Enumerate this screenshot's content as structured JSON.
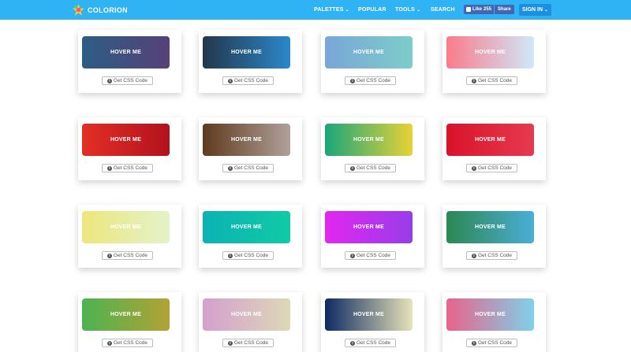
{
  "header": {
    "brand": "COLORION",
    "nav": [
      {
        "label": "PALETTES",
        "caret": "⌄"
      },
      {
        "label": "POPULAR",
        "caret": ""
      },
      {
        "label": "TOOLS",
        "caret": "⌄"
      },
      {
        "label": "SEARCH",
        "caret": ""
      }
    ],
    "facebook": {
      "like_label": "Like",
      "like_count": "255",
      "share_label": "Share"
    },
    "signin_label": "SIGN IN",
    "signin_caret": "⌄"
  },
  "gradients": {
    "button_label": "HOVER ME",
    "code_button_label": "Get CSS Code",
    "items": [
      {
        "from": "#2c5d84",
        "to": "#574178"
      },
      {
        "from": "#23374a",
        "to": "#2b88cb"
      },
      {
        "from": "#7aa6d8",
        "to": "#7ccdc9"
      },
      {
        "from": "#fa7b8a",
        "to": "#cfe8fb"
      },
      {
        "from": "#e42f26",
        "to": "#b2121d"
      },
      {
        "from": "#5f3a1d",
        "to": "#b0a09a"
      },
      {
        "from": "#1aa67a",
        "to": "#e8d236"
      },
      {
        "from": "#d8132a",
        "to": "#e73a4f"
      },
      {
        "from": "#ece67c",
        "to": "#e4f3c9"
      },
      {
        "from": "#0cb2b3",
        "to": "#10cba6"
      },
      {
        "from": "#e227f0",
        "to": "#973de9"
      },
      {
        "from": "#2d8752",
        "to": "#4aaed7"
      },
      {
        "from": "#4cb351",
        "to": "#b2a235"
      },
      {
        "from": "#d59fcf",
        "to": "#ddd8b7"
      },
      {
        "from": "#0f2a63",
        "to": "#e7e3b8"
      },
      {
        "from": "#e9638a",
        "to": "#7fd0ea"
      }
    ]
  },
  "colors": {
    "nav_bg": "#30b3f5",
    "fb_blue": "#4267b2",
    "signin_bg": "#1c8fe0"
  },
  "icons": [
    "colorion-logo-icon",
    "caret-down-icon",
    "thumbs-up-icon",
    "info-icon"
  ]
}
